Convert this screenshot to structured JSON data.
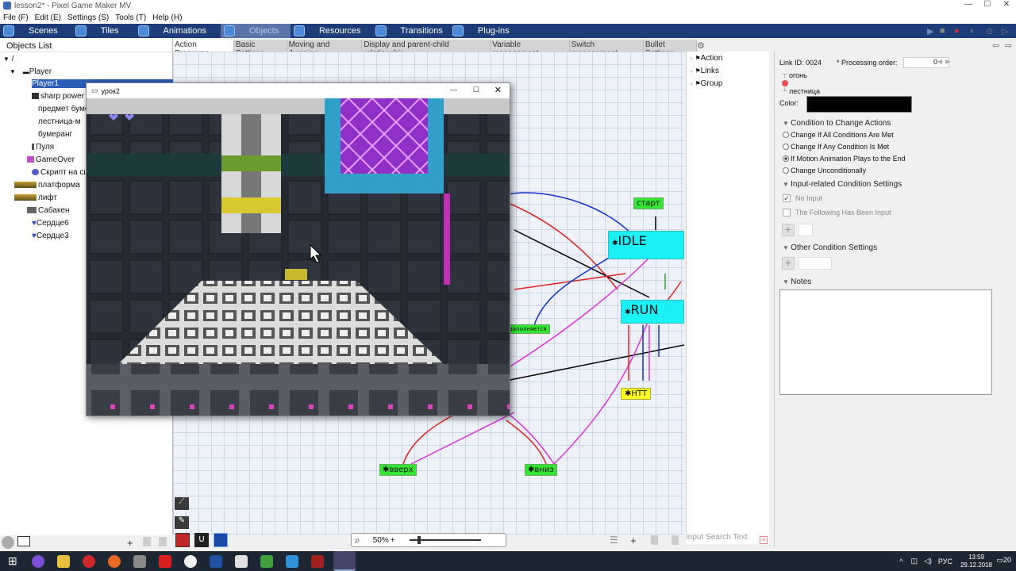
{
  "window": {
    "title": "lesson2* - Pixel Game Maker MV"
  },
  "menu": [
    "File (F)",
    "Edit (E)",
    "Settings (S)",
    "Tools (T)",
    "Help (H)"
  ],
  "main_tabs": [
    "Scenes",
    "Tiles",
    "Animations",
    "Objects",
    "Resources",
    "Transitions",
    "Plug-ins"
  ],
  "active_main_tab": "Objects",
  "objects_list": {
    "title": "Objects List",
    "root": "/",
    "items": [
      "Player",
      "Player1",
      "sharp power",
      "предмет буме",
      "лестница-м",
      "бумеранг",
      "Пуля",
      "GameOver",
      "Скрипт на сц",
      "платформа",
      "лифт",
      "Сабакен",
      "Сердце6",
      "Сердце3"
    ]
  },
  "sub_tabs": [
    "Action Programs",
    "Basic Settings",
    "Moving and Jumping",
    "Display and parent-child relationship",
    "Variable management",
    "Switch management",
    "Bullet Settings"
  ],
  "game_window": {
    "title": "урок2"
  },
  "nodes": {
    "start": "старт",
    "idle": "IDLE",
    "run": "RUN",
    "hit": "НТТ",
    "up": "вверх",
    "down": "вниз",
    "partial": "заполняется"
  },
  "zoom": {
    "value": "50%"
  },
  "link_panel": {
    "items": [
      "Action",
      "Links",
      "Group"
    ],
    "search_placeholder": "Input Search Text"
  },
  "props": {
    "link_id": "Link ID: 0024",
    "processing_order_label": "* Processing order:",
    "processing_order": "0",
    "from": "огонь",
    "to": "лестница",
    "color_label": "Color:",
    "color_value": "#000000",
    "condition_header": "Condition to Change Actions",
    "conditions": [
      "Change If All Conditions Are Met",
      "Change If Any Condition Is Met",
      "If Motion Animation Plays to the End",
      "Change Unconditionally"
    ],
    "selected_condition": 2,
    "input_header": "Input-related Condition Settings",
    "no_input": "No Input",
    "following_pressed": "The Following Has Been Input",
    "other_header": "Other Condition Settings",
    "notes_header": "Notes"
  },
  "tray": {
    "lang": "РУС",
    "time": "13:59",
    "date": "29.12.2018",
    "notif": "20"
  }
}
